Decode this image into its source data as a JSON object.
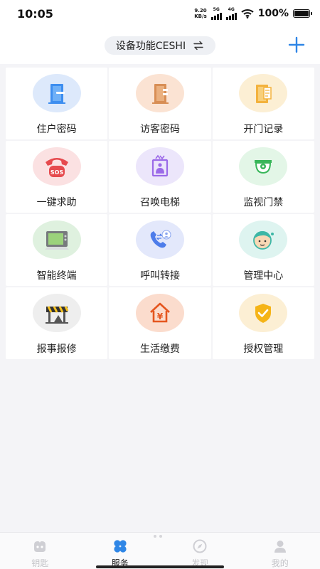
{
  "status_bar": {
    "time": "10:05",
    "net_speed_value": "9.20",
    "net_speed_unit": "KB/s",
    "sim1_label": "5G",
    "sim2_label": "4G",
    "battery_percent": "100%"
  },
  "header": {
    "device_name": "设备功能CESHI"
  },
  "tiles": [
    {
      "label": "住户密码",
      "icon": "door-icon",
      "bg": "#dde9fb"
    },
    {
      "label": "访客密码",
      "icon": "visitor-door-icon",
      "bg": "#fbe3d3"
    },
    {
      "label": "开门记录",
      "icon": "door-record-icon",
      "bg": "#fcefd4"
    },
    {
      "label": "一键求助",
      "icon": "sos-phone-icon",
      "bg": "#fbe1e2"
    },
    {
      "label": "召唤电梯",
      "icon": "elevator-icon",
      "bg": "#ece6fb"
    },
    {
      "label": "监视门禁",
      "icon": "camera-icon",
      "bg": "#e3f6e7"
    },
    {
      "label": "智能终端",
      "icon": "terminal-icon",
      "bg": "#dff1df"
    },
    {
      "label": "呼叫转接",
      "icon": "call-transfer-icon",
      "bg": "#e3e8fb"
    },
    {
      "label": "管理中心",
      "icon": "manager-icon",
      "bg": "#def4f0"
    },
    {
      "label": "报事报修",
      "icon": "repair-barrier-icon",
      "bg": "#eeeeee"
    },
    {
      "label": "生活缴费",
      "icon": "payment-house-icon",
      "bg": "#fbdccd"
    },
    {
      "label": "授权管理",
      "icon": "shield-check-icon",
      "bg": "#fcefd4"
    }
  ],
  "bottom_nav": [
    {
      "label": "钥匙",
      "icon": "key-icon",
      "active": false
    },
    {
      "label": "服务",
      "icon": "clover-icon",
      "active": true
    },
    {
      "label": "发现",
      "icon": "compass-icon",
      "active": false
    },
    {
      "label": "我的",
      "icon": "person-icon",
      "active": false
    }
  ],
  "colors": {
    "accent": "#2f86e6",
    "active_nav": "#2f86e6",
    "inactive_nav": "#c4c4c8"
  }
}
